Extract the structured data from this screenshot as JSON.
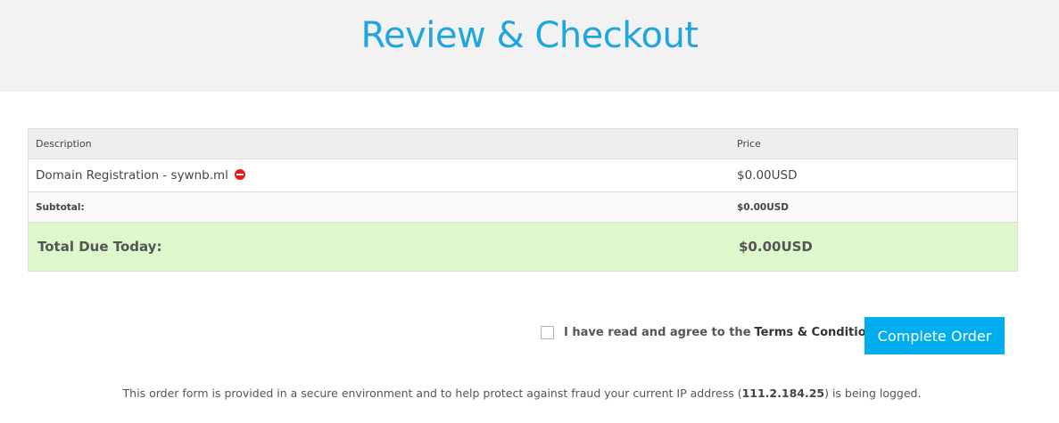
{
  "header": {
    "title": "Review & Checkout"
  },
  "cart": {
    "columns": {
      "description": "Description",
      "price": "Price"
    },
    "items": [
      {
        "description": "Domain Registration - sywnb.ml",
        "price": "$0.00USD",
        "action_icon": "remove-icon"
      }
    ],
    "subtotal": {
      "label": "Subtotal:",
      "value": "$0.00USD"
    },
    "total": {
      "label": "Total Due Today:",
      "value": "$0.00USD"
    }
  },
  "agreement": {
    "checked": false,
    "text": "I have read and agree to the",
    "terms_link": "Terms & Conditions"
  },
  "complete_button": "Complete Order",
  "secure_notice": {
    "before": "This order form is provided in a secure environment and to help protect against fraud your current IP address (",
    "ip": "111.2.184.25",
    "after": ") is being logged."
  },
  "colors": {
    "accent": "#00aeef",
    "title": "#1fa5e0",
    "total_bg": "#dff7cc",
    "remove": "#e41b1b"
  }
}
